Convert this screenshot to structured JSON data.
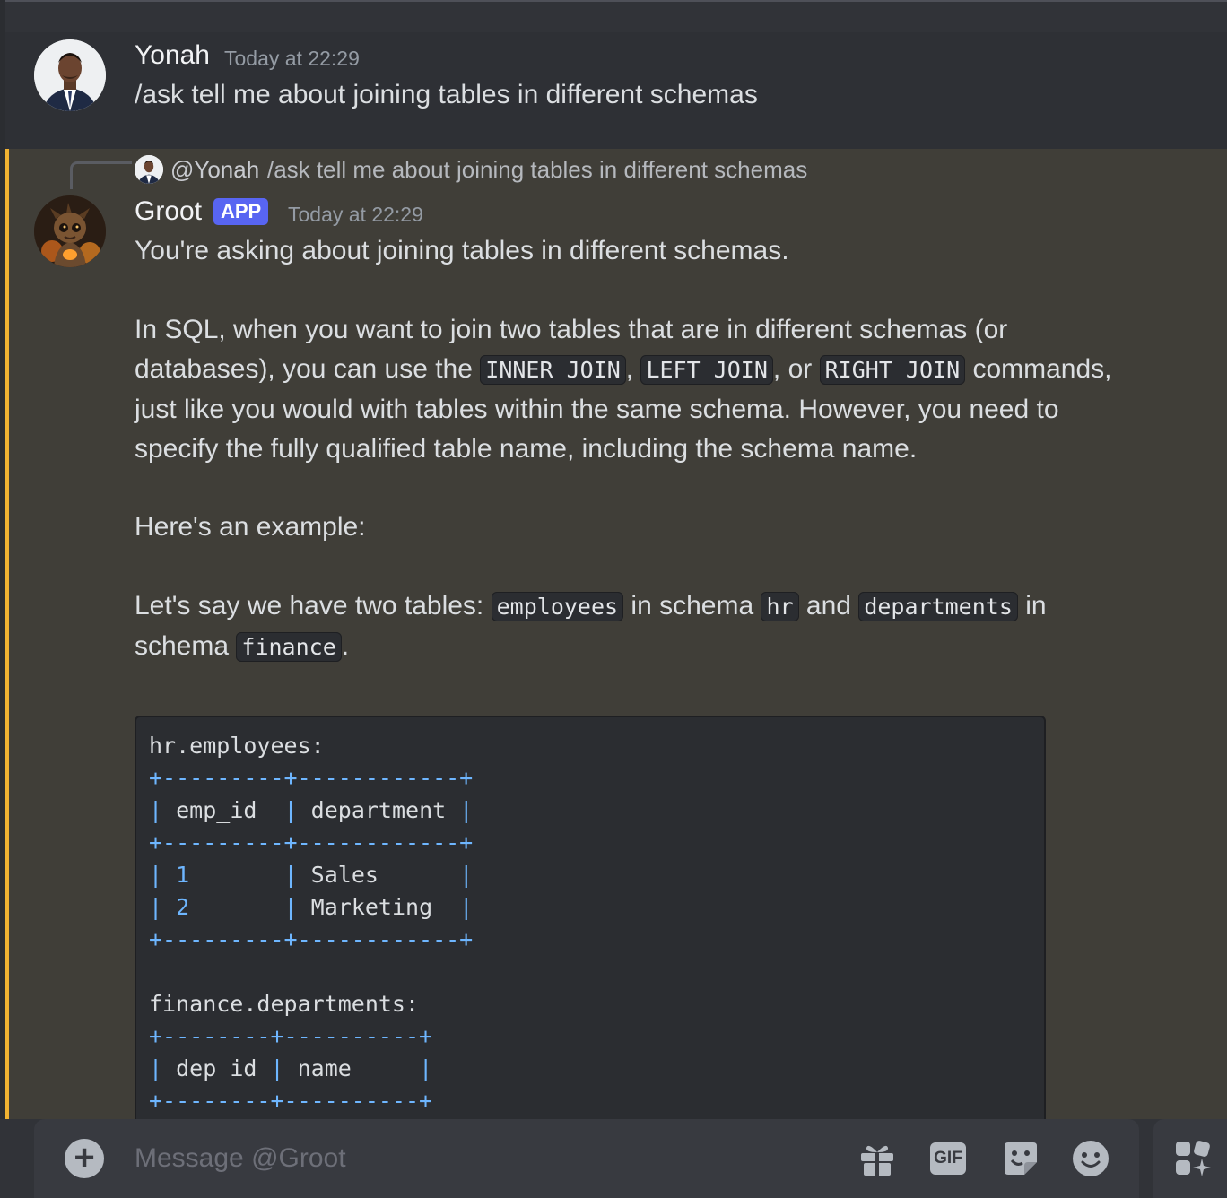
{
  "user_message": {
    "author": "Yonah",
    "timestamp": "Today at 22:29",
    "text": "/ask tell me about joining tables in different schemas"
  },
  "bot_message": {
    "reply_to": {
      "mention": "@Yonah",
      "text": "/ask tell me about joining tables in different schemas"
    },
    "author": "Groot",
    "badge": "APP",
    "timestamp": "Today at 22:29",
    "p1": "You're asking about joining tables in different schemas.",
    "p2": {
      "a": "In SQL, when you want to join two tables that are in different schemas (or databases), you can use the ",
      "c1": "INNER JOIN",
      "s1": ", ",
      "c2": "LEFT JOIN",
      "s2": ", or ",
      "c3": "RIGHT JOIN",
      "b": " commands, just like you would with tables within the same schema. However, you need to specify the fully qualified table name, including the schema name."
    },
    "p3": "Here's an example:",
    "p4": {
      "a": "Let's say we have two tables: ",
      "c1": "employees",
      "b": " in schema ",
      "c2": "hr",
      "c": " and ",
      "c3": "departments",
      "d": " in schema ",
      "c4": "finance",
      "e": "."
    },
    "code": {
      "t1": "hr.employees:",
      "t1_border": "+---------+------------+",
      "t1_header": [
        "emp_id",
        "department"
      ],
      "t1_rows": [
        [
          "1",
          "Sales"
        ],
        [
          "2",
          "Marketing"
        ]
      ],
      "t2": "finance.departments:",
      "t2_border": "+--------+----------+",
      "t2_header": [
        "dep_id",
        "name"
      ]
    }
  },
  "composer": {
    "placeholder": "Message @Groot",
    "gif_label": "GIF"
  },
  "icons": [
    "plus-icon",
    "gift-icon",
    "gif-icon",
    "sticker-icon",
    "emoji-icon",
    "apps-icon"
  ]
}
